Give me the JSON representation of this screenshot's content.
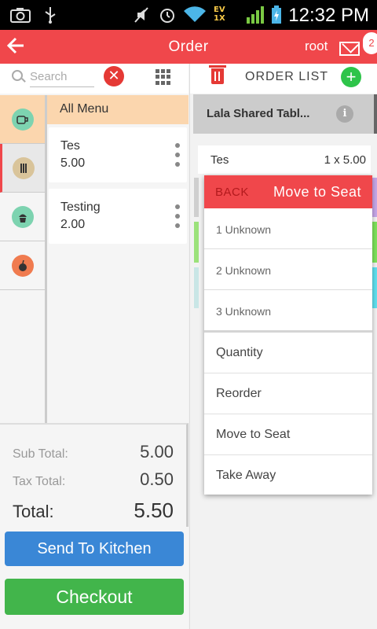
{
  "status_bar": {
    "time": "12:32 PM",
    "network_label_top": "EV",
    "network_label_bottom": "1X",
    "icons": [
      "camera-icon",
      "usb-icon",
      "mute-icon",
      "alarm-icon",
      "wifi-icon",
      "signal-icon",
      "battery-icon"
    ]
  },
  "app_bar": {
    "title": "Order",
    "user": "root",
    "notification_count": "2",
    "color": "#f0474b"
  },
  "search": {
    "placeholder": "Search",
    "value": ""
  },
  "categories": {
    "header": "All Menu",
    "items": [
      {
        "icon": "category-drink-icon",
        "color": "#7dd3b0"
      },
      {
        "icon": "category-utensils-icon",
        "color": "#d9c49a"
      },
      {
        "icon": "category-cupcake-icon",
        "color": "#7dd3b0"
      },
      {
        "icon": "category-apple-icon",
        "color": "#f07b4f"
      }
    ]
  },
  "menu_items": [
    {
      "name": "Tes",
      "price": "5.00"
    },
    {
      "name": "Testing",
      "price": "2.00"
    }
  ],
  "totals": {
    "sub_total_label": "Sub Total:",
    "sub_total": "5.00",
    "tax_total_label": "Tax Total:",
    "tax_total": "0.50",
    "total_label": "Total:",
    "total": "5.50"
  },
  "buttons": {
    "send_to_kitchen": "Send To Kitchen",
    "checkout": "Checkout"
  },
  "order_list": {
    "title": "ORDER LIST",
    "table_name": "Lala Shared Tabl...",
    "items": [
      {
        "name": "Tes",
        "qty": "1 x 5.00"
      }
    ]
  },
  "popup": {
    "back_label": "BACK",
    "title": "Move to Seat",
    "seats": [
      "1 Unknown",
      "2 Unknown",
      "3 Unknown"
    ],
    "actions": [
      "Quantity",
      "Reorder",
      "Move to Seat",
      "Take Away"
    ]
  }
}
